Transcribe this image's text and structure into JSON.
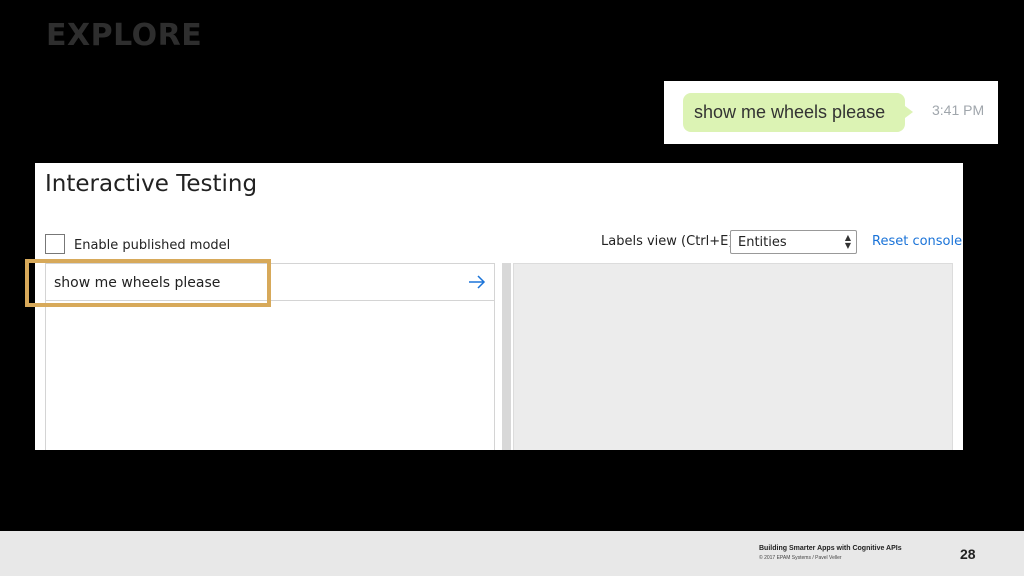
{
  "slide": {
    "title": "EXPLORE",
    "page_number": "28"
  },
  "chat": {
    "message": "show me wheels please",
    "time": "3:41 PM",
    "bubble_color": "#dcf3b4"
  },
  "testing_panel": {
    "title": "Interactive Testing",
    "enable_published_label": "Enable published model",
    "enable_published_checked": false,
    "labels_view_label": "Labels view (Ctrl+E)",
    "labels_view_selected": "Entities",
    "reset_label": "Reset console",
    "utterance_value": "show me wheels please",
    "send_icon": "arrow-right-icon",
    "link_color": "#1a73d8"
  },
  "highlight": {
    "color": "#d7a95a"
  },
  "footer": {
    "title": "Building Smarter Apps with Cognitive APIs",
    "copyright": "© 2017 EPAM Systems / Pavel Veller"
  }
}
